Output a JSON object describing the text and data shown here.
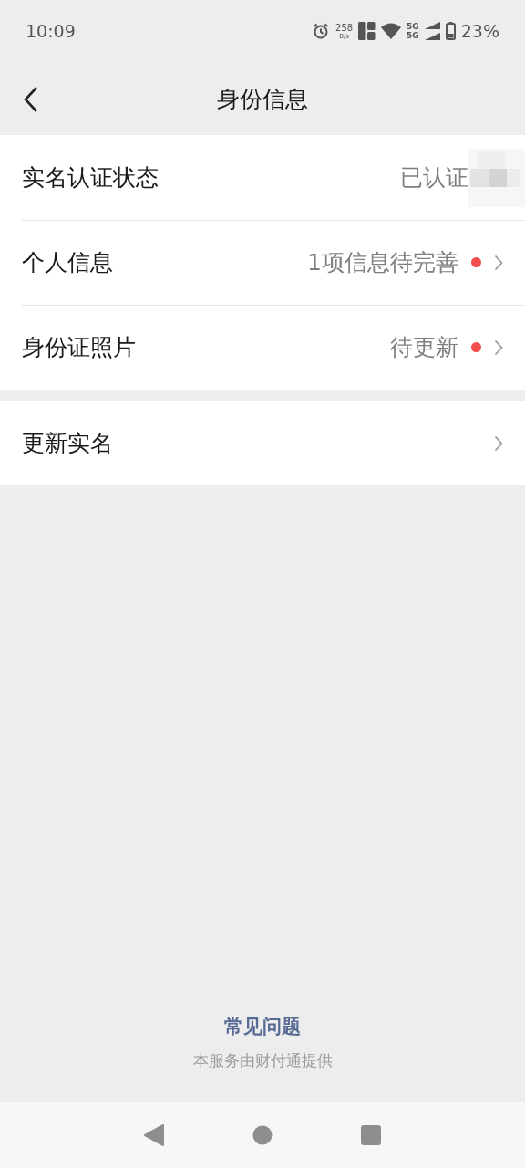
{
  "status_bar": {
    "time": "10:09",
    "speed": "258",
    "speed_unit": "B/s",
    "sim_top": "5G",
    "sim_bottom": "5G",
    "battery": "23%"
  },
  "header": {
    "title": "身份信息"
  },
  "sections": [
    {
      "rows": [
        {
          "label": "实名认证状态",
          "value": "已认证",
          "kind": "plain",
          "alert": false,
          "masked": true
        },
        {
          "label": "个人信息",
          "value": "1项信息待完善",
          "kind": "link",
          "alert": true,
          "masked": false
        },
        {
          "label": "身份证照片",
          "value": "待更新",
          "kind": "link",
          "alert": true,
          "masked": false
        }
      ]
    },
    {
      "rows": [
        {
          "label": "更新实名",
          "kind": "link",
          "alert": false,
          "masked": false
        }
      ]
    }
  ],
  "footer": {
    "faq_link": "常见问题",
    "provider_note": "本服务由财付通提供"
  }
}
